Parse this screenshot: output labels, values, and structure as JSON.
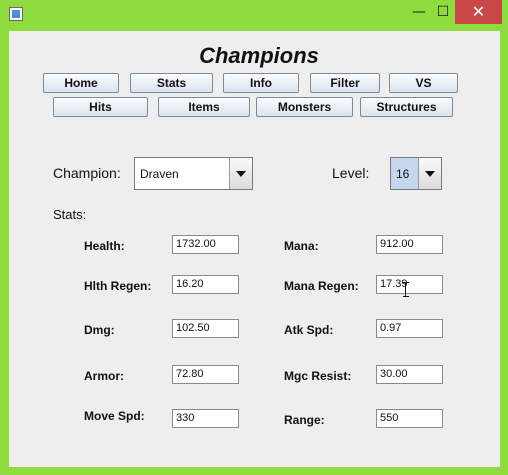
{
  "window": {
    "min_glyph": "—",
    "max_glyph": "☐",
    "close_glyph": "✕"
  },
  "app": {
    "title": "Champions"
  },
  "nav_row1": [
    "Home",
    "Stats",
    "Info",
    "Filter",
    "VS"
  ],
  "nav_row2": [
    "Hits",
    "Items",
    "Monsters",
    "Structures"
  ],
  "champion": {
    "label": "Champion:",
    "value": "Draven"
  },
  "level": {
    "label": "Level:",
    "value": "16"
  },
  "stats_header": "Stats:",
  "stats": {
    "health": {
      "label": "Health:",
      "value": "1732.00"
    },
    "mana": {
      "label": "Mana:",
      "value": "912.00"
    },
    "hlth_regen": {
      "label": "Hlth Regen:",
      "value": "16.20"
    },
    "mana_regen": {
      "label": "Mana Regen:",
      "value": "17.39"
    },
    "dmg": {
      "label": "Dmg:",
      "value": "102.50"
    },
    "atk_spd": {
      "label": "Atk Spd:",
      "value": "0.97"
    },
    "armor": {
      "label": "Armor:",
      "value": "72.80"
    },
    "mgc_resist": {
      "label": "Mgc Resist:",
      "value": "30.00"
    },
    "move_spd": {
      "label": "Move Spd:",
      "value": "330"
    },
    "range": {
      "label": "Range:",
      "value": "550"
    }
  },
  "colors": {
    "frame": "#8fdc3e",
    "close": "#c84747",
    "client": "#eeeeee"
  }
}
